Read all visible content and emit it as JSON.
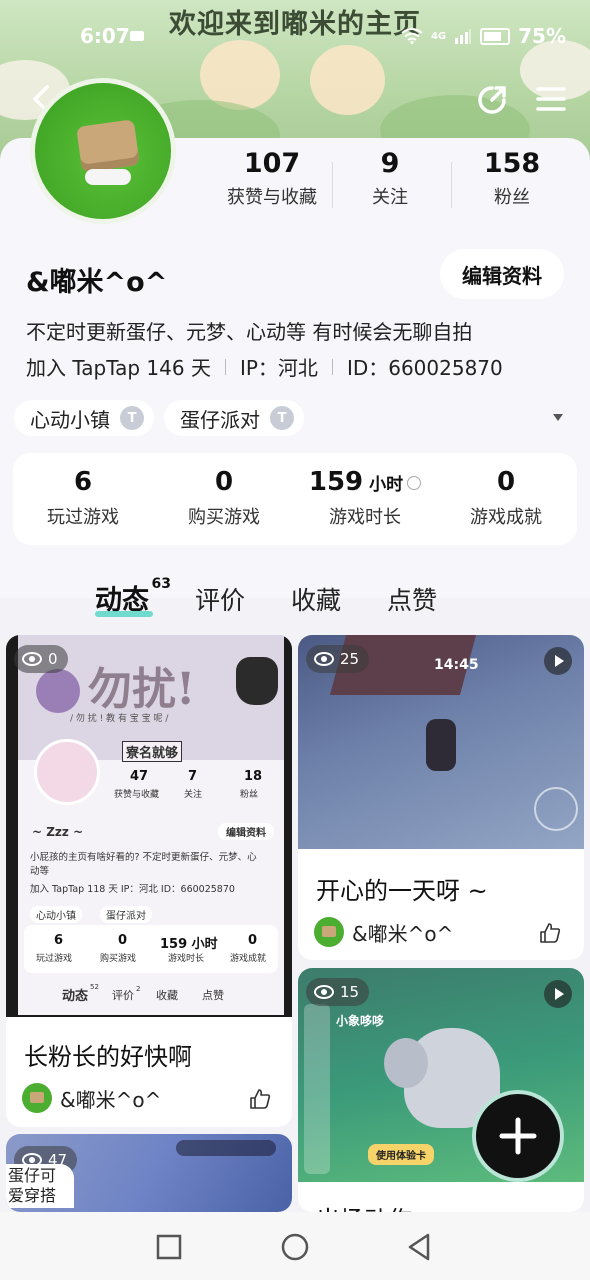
{
  "status_bar": {
    "time": "6:07",
    "battery": "75%",
    "network": "4G"
  },
  "banner": {
    "title": "欢迎来到嘟米的主页"
  },
  "profile": {
    "stats": [
      {
        "value": "107",
        "label": "获赞与收藏"
      },
      {
        "value": "9",
        "label": "关注"
      },
      {
        "value": "158",
        "label": "粉丝"
      }
    ],
    "username": "&嘟米^o^",
    "edit_label": "编辑资料",
    "bio": "不定时更新蛋仔、元梦、心动等 有时候会无聊自拍",
    "joined": "加入 TapTap 146 天",
    "ip": "IP：河北",
    "id": "ID：660025870",
    "tags": [
      {
        "name": "心动小镇",
        "badge": "T"
      },
      {
        "name": "蛋仔派对",
        "badge": "T"
      }
    ]
  },
  "game_stats": [
    {
      "value": "6",
      "unit": "",
      "label": "玩过游戏"
    },
    {
      "value": "0",
      "unit": "",
      "label": "购买游戏"
    },
    {
      "value": "159",
      "unit": "小时",
      "label": "游戏时长"
    },
    {
      "value": "0",
      "unit": "",
      "label": "游戏成就"
    }
  ],
  "tabs": [
    {
      "label": "动态",
      "count": "63",
      "active": true
    },
    {
      "label": "评价"
    },
    {
      "label": "收藏"
    },
    {
      "label": "点赞"
    }
  ],
  "feed": [
    {
      "views": "0",
      "title": "长粉长的好快啊",
      "author": "&嘟米^o^",
      "screenshot": {
        "banner_text": "勿扰!",
        "banner_sub": "/ 勿 扰 ! 教 有 宝 宝 呢 /",
        "sign": "寮名就够",
        "stats": [
          {
            "value": "47",
            "label": "获赞与收藏"
          },
          {
            "value": "7",
            "label": "关注"
          },
          {
            "value": "18",
            "label": "粉丝"
          }
        ],
        "username": "~ Zzz ~",
        "edit": "编辑资料",
        "bio": "小屁孩的主页有啥好看的? 不定时更新蛋仔、元梦、心",
        "bio2": "动等",
        "meta": "加入 TapTap 118 天   IP：河北   ID：660025870",
        "tags": [
          "心动小镇",
          "蛋仔派对"
        ],
        "game_stats": [
          {
            "value": "6",
            "label": "玩过游戏"
          },
          {
            "value": "0",
            "label": "购买游戏"
          },
          {
            "value": "159 小时",
            "label": "游戏时长"
          },
          {
            "value": "0",
            "label": "游戏成就"
          }
        ],
        "tabs": [
          "动态",
          "评价",
          "收藏",
          "点赞"
        ],
        "tab_counts": {
          "dongtai": "52",
          "pingjia": "2"
        }
      }
    },
    {
      "views": "25",
      "title": "开心的一天呀 ~",
      "author": "&嘟米^o^",
      "timer": "14:45"
    },
    {
      "views": "15",
      "title": "出场动作",
      "game_text": "小象哆哆",
      "game_btn": "使用体验卡"
    },
    {
      "views": "47",
      "overlay_text": "蛋仔可\n爱穿搭"
    }
  ]
}
